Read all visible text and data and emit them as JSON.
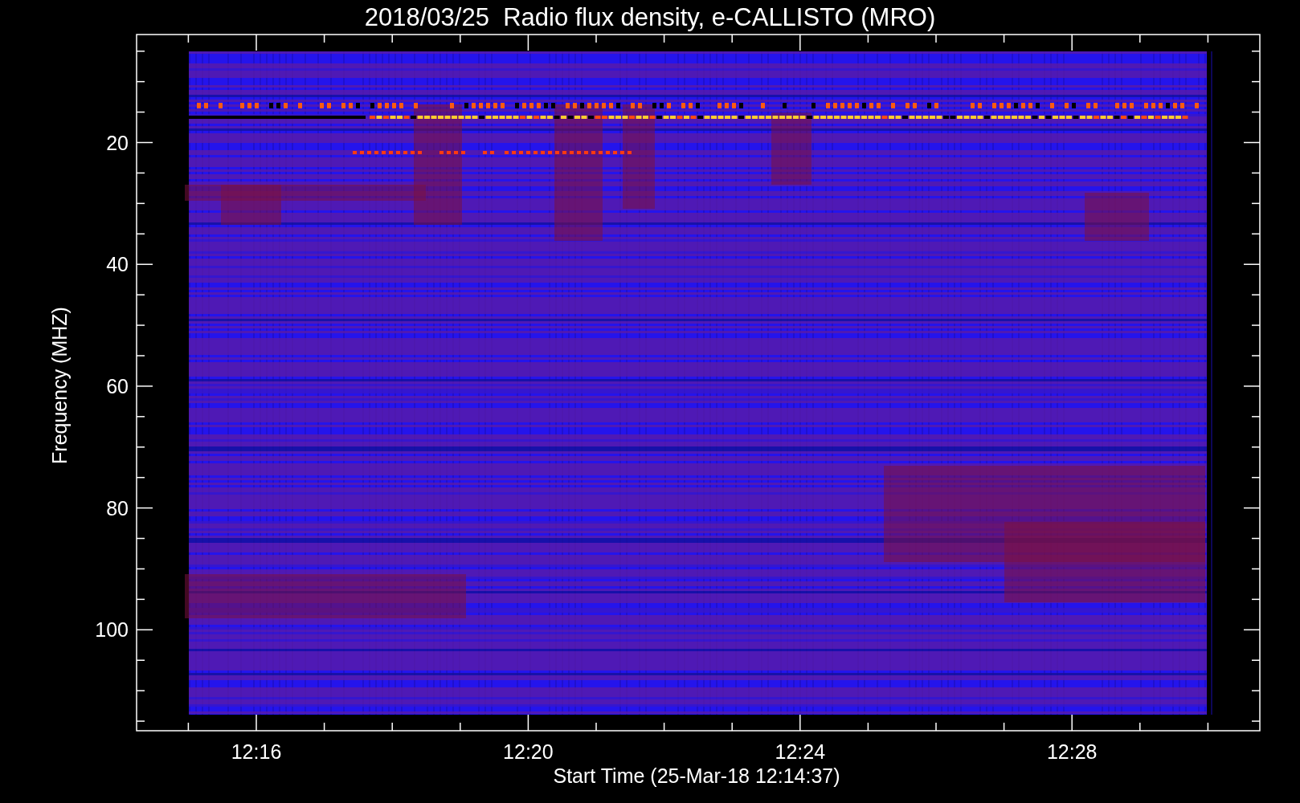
{
  "title": "2018/03/25  Radio flux density, e-CALLISTO (MRO)",
  "y_axis": {
    "label": "Frequency (MHZ)",
    "tick_labels": [
      "20",
      "40",
      "60",
      "80",
      "100"
    ]
  },
  "x_axis": {
    "label": "Start Time (25-Mar-18 12:14:37)",
    "tick_labels": [
      "12:16",
      "12:20",
      "12:24",
      "12:28"
    ]
  }
}
